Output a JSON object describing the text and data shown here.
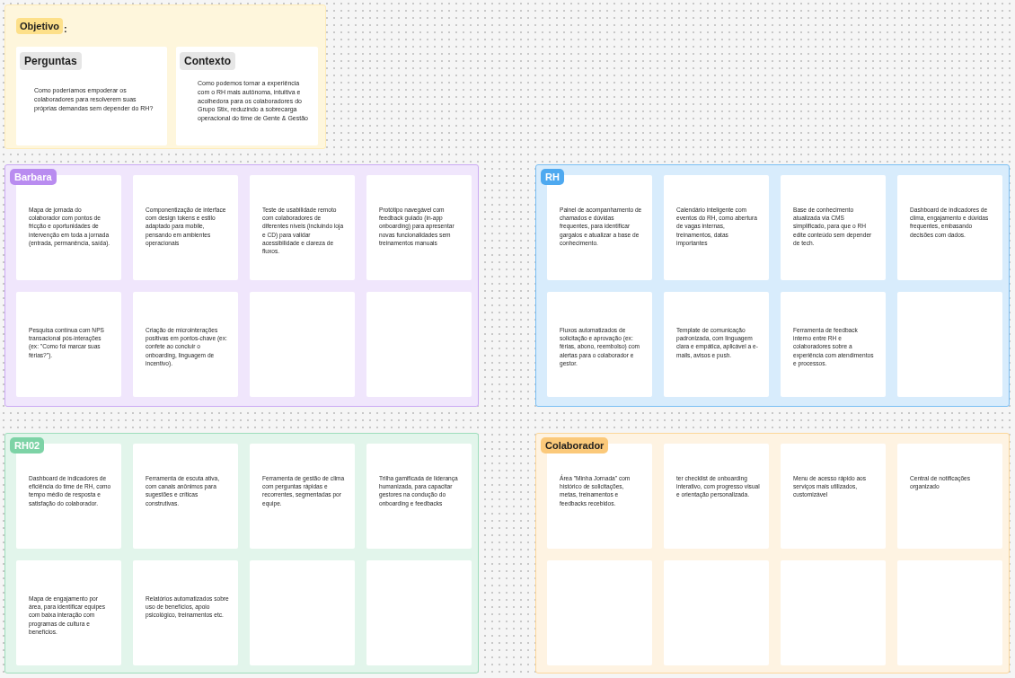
{
  "objective": {
    "title": "Objetivo",
    "title_suffix": ":",
    "color": "#fde08a",
    "cards": [
      {
        "title": "Perguntas",
        "text": "Como poderíamos empoderar os colaboradores para resolverem suas próprias demandas sem depender do RH?"
      },
      {
        "title": "Contexto",
        "text": "Como podemos tornar a experiência com o RH mais autônoma, intuitiva e acolhedora para os colaboradores do Grupo Stix, reduzindo a sobrecarga operacional do time de Gente & Gestão"
      }
    ]
  },
  "sections": [
    {
      "title": "Barbara",
      "color": "#b98cf0",
      "notes": [
        {
          "kind": "text",
          "text": "Mapa de jornada do colaborador com pontos de fricção e oportunidades de intervenção em toda a jornada (entrada, permanência, saída)."
        },
        {
          "kind": "text",
          "text": "Componentização de interface com design tokens e estilo adaptado para mobile, pensando em ambientes operacionais"
        },
        {
          "kind": "text",
          "text": "Teste de usabilidade remoto com colaboradores de diferentes níveis (incluindo loja e CD) para validar acessibilidade e clareza de fluxos."
        },
        {
          "kind": "text",
          "text": "Protótipo navegável com feedback guiado (in-app onboarding) para apresentar novas funcionalidades sem treinamentos manuais"
        },
        {
          "kind": "text",
          "text": "Pesquisa contínua com NPS transacional pós-interações (ex: \"Como foi marcar suas férias?\")."
        },
        {
          "kind": "text",
          "text": "Criação de microinterações positivas em pontos-chave (ex: confete ao concluir o onboarding, linguagem de incentivo)."
        },
        {
          "kind": "blank"
        },
        {
          "kind": "blank"
        }
      ]
    },
    {
      "title": "RH",
      "color": "#4ea9f0",
      "notes": [
        {
          "kind": "text",
          "text": "Painel de acompanhamento de chamados e dúvidas frequentes, para identificar gargalos e atualizar a base de conhecimento."
        },
        {
          "kind": "text",
          "text": "Calendário inteligente com eventos do RH, como abertura de vagas internas, treinamentos, datas importantes"
        },
        {
          "kind": "text",
          "text": "Base de conhecimento atualizada via CMS simplificado, para que o RH edite conteúdo sem depender de tech."
        },
        {
          "kind": "text",
          "text": "Dashboard de indicadores de clima, engajamento e dúvidas frequentes, embasando decisões com dados."
        },
        {
          "kind": "text",
          "text": "Fluxos automatizados de solicitação e aprovação (ex: férias, abono, reembolso) com alertas para o colaborador e gestor."
        },
        {
          "kind": "text",
          "text": "Template de comunicação padronizada, com linguagem clara e empática, aplicável a e-mails, avisos e push."
        },
        {
          "kind": "text",
          "text": "Ferramenta de feedback interno entre RH e colaboradores sobre a experiência com atendimentos e processos."
        },
        {
          "kind": "blank"
        }
      ]
    },
    {
      "title": "RH02",
      "color": "#7dd3a6",
      "notes": [
        {
          "kind": "text",
          "text": "Dashboard de indicadores de eficiência do time de RH, como tempo médio de resposta e satisfação do colaborador."
        },
        {
          "kind": "text",
          "text": "Ferramenta de escuta ativa, com canais anônimos para sugestões e críticas construtivas."
        },
        {
          "kind": "text",
          "text": "Ferramenta de gestão de clima com perguntas rápidas e recorrentes, segmentadas por equipe."
        },
        {
          "kind": "text",
          "text": "Trilha gamificada de liderança humanizada, para capacitar gestores na condução do onboarding e feedbacks"
        },
        {
          "kind": "text",
          "text": "Mapa de engajamento por área, para identificar equipes com baixa interação com programas de cultura e benefícios."
        },
        {
          "kind": "text",
          "text": "Relatórios automatizados sobre uso de benefícios, apoio psicológico, treinamentos etc."
        },
        {
          "kind": "blank"
        },
        {
          "kind": "blank"
        }
      ]
    },
    {
      "title": "Colaborador",
      "color": "#fbc97a",
      "notes": [
        {
          "kind": "text",
          "text": "Área \"Minha Jornada\" com histórico de solicitações, metas, treinamentos e feedbacks recebidos."
        },
        {
          "kind": "text",
          "text": "ter checklist de onboarding interativo, com progresso visual e orientação personalizada."
        },
        {
          "kind": "text",
          "text": "Menu de acesso rápido aos serviços mais utilizados, customizável"
        },
        {
          "kind": "text",
          "text": "Central de notificações organizado"
        },
        {
          "kind": "blank"
        },
        {
          "kind": "blank"
        },
        {
          "kind": "blank"
        },
        {
          "kind": "blank"
        }
      ]
    }
  ]
}
